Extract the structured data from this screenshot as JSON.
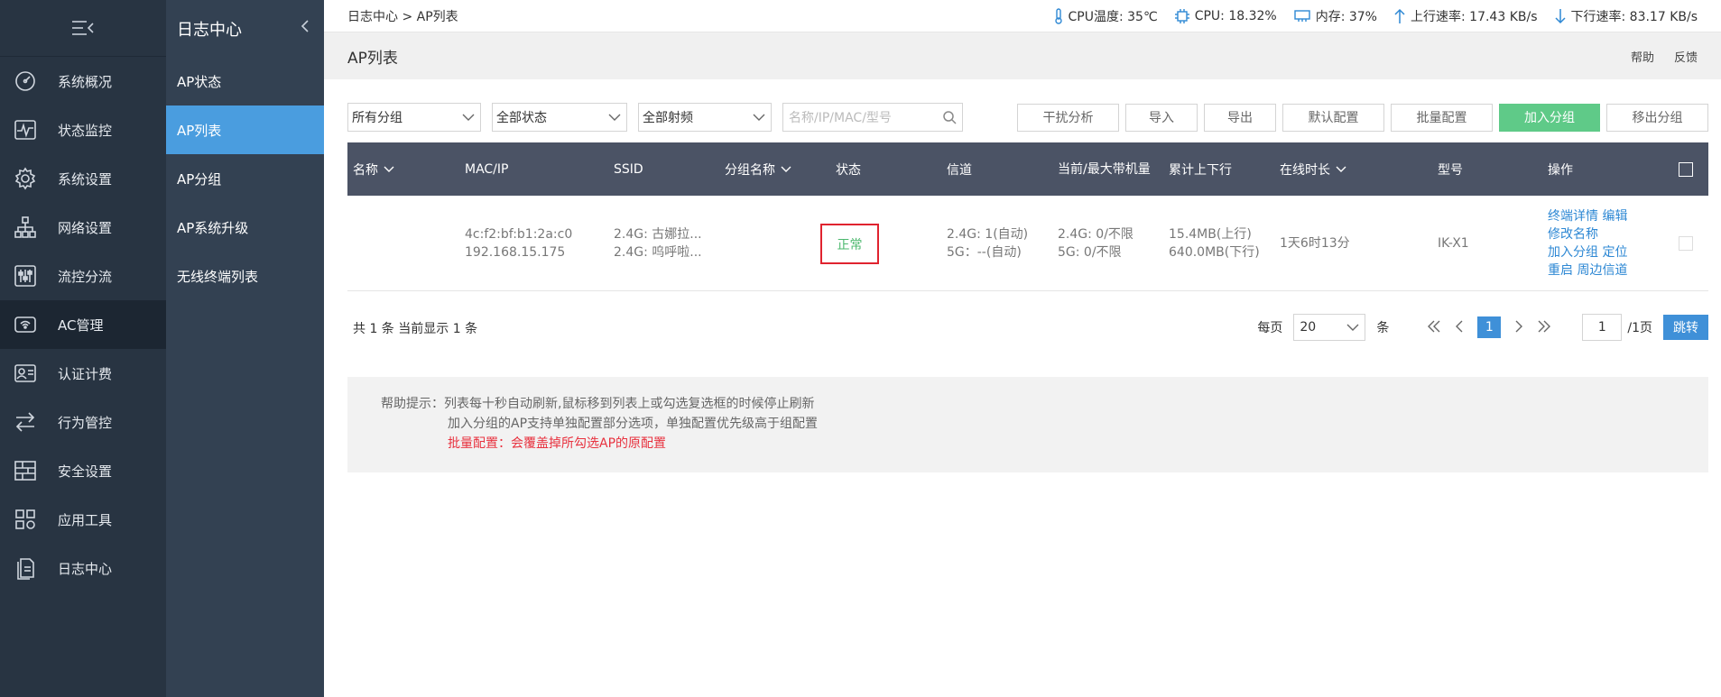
{
  "sidebar": {
    "items": [
      {
        "label": "系统概况",
        "icon": "dashboard-icon"
      },
      {
        "label": "状态监控",
        "icon": "monitor-icon"
      },
      {
        "label": "系统设置",
        "icon": "gear-icon"
      },
      {
        "label": "网络设置",
        "icon": "network-icon"
      },
      {
        "label": "流控分流",
        "icon": "sliders-icon"
      },
      {
        "label": "AC管理",
        "icon": "wifi-router-icon"
      },
      {
        "label": "认证计费",
        "icon": "id-card-icon"
      },
      {
        "label": "行为管控",
        "icon": "swap-arrows-icon"
      },
      {
        "label": "安全设置",
        "icon": "firewall-icon"
      },
      {
        "label": "应用工具",
        "icon": "apps-icon"
      },
      {
        "label": "日志中心",
        "icon": "log-file-icon"
      }
    ]
  },
  "subnav": {
    "title": "日志中心",
    "items": [
      {
        "label": "AP状态"
      },
      {
        "label": "AP列表"
      },
      {
        "label": "AP分组"
      },
      {
        "label": "AP系统升级"
      },
      {
        "label": "无线终端列表"
      }
    ]
  },
  "topbar": {
    "breadcrumb": "日志中心 > AP列表",
    "cpu_temp": "CPU温度: 35℃",
    "cpu": "CPU: 18.32%",
    "memory": "内存: 37%",
    "upload": "上行速率: 17.43 KB/s",
    "download": "下行速率: 83.17 KB/s"
  },
  "page": {
    "title": "AP列表",
    "help": "帮助",
    "feedback": "反馈"
  },
  "filters": {
    "group": "所有分组",
    "status": "全部状态",
    "freq": "全部射频",
    "search_placeholder": "名称/IP/MAC/型号"
  },
  "actions": {
    "interference": "干扰分析",
    "import": "导入",
    "export": "导出",
    "default_config": "默认配置",
    "batch_config": "批量配置",
    "add_group": "加入分组",
    "remove_group": "移出分组"
  },
  "table": {
    "headers": {
      "name": "名称",
      "mac_ip": "MAC/IP",
      "ssid": "SSID",
      "group": "分组名称",
      "status": "状态",
      "channel": "信道",
      "clients": "当前/最大带机量",
      "traffic": "累计上下行",
      "uptime": "在线时长",
      "model": "型号",
      "ops": "操作"
    },
    "rows": [
      {
        "name": "",
        "mac": "4c:f2:bf:b1:2a:c0",
        "ip": "192.168.15.175",
        "ssid1": "2.4G: 古娜拉...",
        "ssid2": "2.4G: 呜呼啦...",
        "group": "",
        "status": "正常",
        "ch1": "2.4G: 1(自动)",
        "ch2": "5G：--(自动)",
        "cl1": "2.4G: 0/不限",
        "cl2": "5G: 0/不限",
        "up": "15.4MB(上行)",
        "down": "640.0MB(下行)",
        "uptime": "1天6时13分",
        "model": "IK-X1",
        "op_detail": "终端详情",
        "op_edit": "编辑",
        "op_rename": "修改名称",
        "op_group": "加入分组",
        "op_locate": "定位",
        "op_reboot": "重启",
        "op_channel": "周边信道"
      }
    ]
  },
  "pager": {
    "total": "共 1 条 当前显示 1 条",
    "per_page_label": "每页",
    "per_page": "20",
    "unit": "条",
    "current": "1",
    "page_input": "1",
    "pages": "/1页",
    "go": "跳转"
  },
  "help_tips": {
    "line1": "帮助提示：列表每十秒自动刷新,鼠标移到列表上或勾选复选框的时候停止刷新",
    "line2": "加入分组的AP支持单独配置部分选项，单独配置优先级高于组配置",
    "line3": "批量配置：会覆盖掉所勾选AP的原配置"
  },
  "colors": {
    "sidebar_bg": "#283442",
    "subnav_bg": "#334152",
    "accent_blue": "#4a9ddf",
    "green": "#5fca88",
    "table_header": "#4b5365",
    "status_ok": "#4cb86e",
    "highlight_red": "#e0232f"
  }
}
